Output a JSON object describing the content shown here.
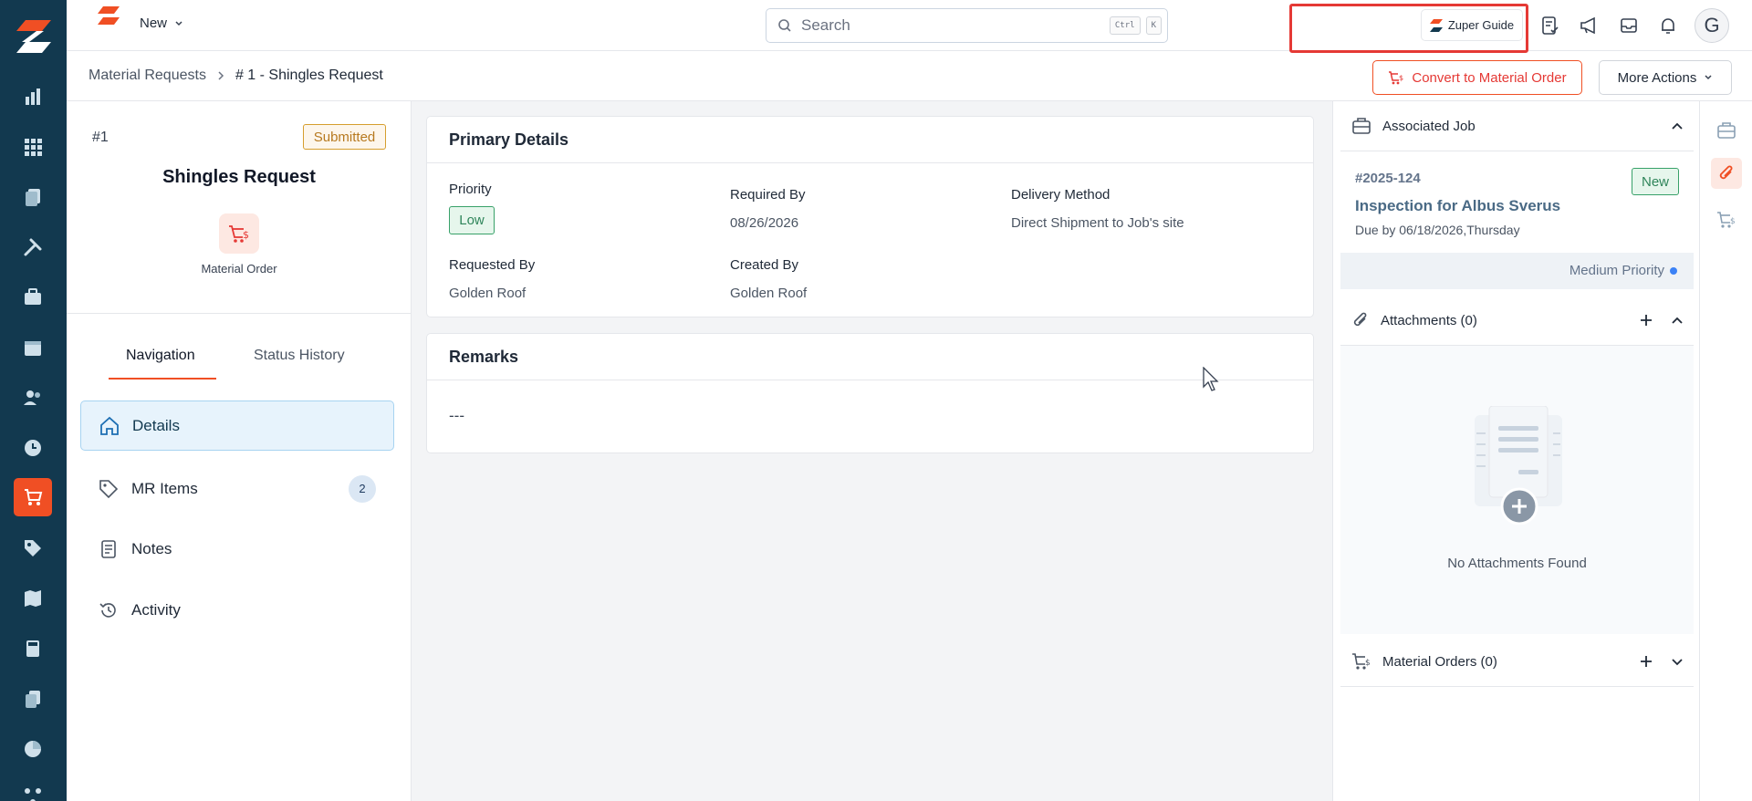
{
  "header": {
    "new_label": "New",
    "search_placeholder": "Search",
    "kbd_ctrl": "Ctrl",
    "kbd_k": "K",
    "guide_label": "Zuper Guide",
    "avatar_initial": "G"
  },
  "breadcrumb": {
    "parent": "Material Requests",
    "current": "# 1 - Shingles Request"
  },
  "actions": {
    "convert_label": "Convert to Material Order",
    "more_label": "More Actions"
  },
  "request": {
    "number": "#1",
    "status": "Submitted",
    "title": "Shingles Request",
    "type_label": "Material Order"
  },
  "nav": {
    "tabs": [
      "Navigation",
      "Status History"
    ],
    "items": [
      {
        "label": "Details"
      },
      {
        "label": "MR Items",
        "count": "2"
      },
      {
        "label": "Notes"
      },
      {
        "label": "Activity"
      }
    ]
  },
  "primary_details": {
    "heading": "Primary Details",
    "priority_label": "Priority",
    "priority_value": "Low",
    "required_by_label": "Required By",
    "required_by_value": "08/26/2026",
    "delivery_label": "Delivery Method",
    "delivery_value": "Direct Shipment to Job's site",
    "requested_by_label": "Requested By",
    "requested_by_value": "Golden Roof",
    "created_by_label": "Created By",
    "created_by_value": "Golden Roof"
  },
  "remarks": {
    "heading": "Remarks",
    "value": "---"
  },
  "associated_job": {
    "heading": "Associated Job",
    "number": "#2025-124",
    "status": "New",
    "title": "Inspection for Albus Sverus",
    "due": "Due by 06/18/2026,Thursday",
    "priority": "Medium Priority"
  },
  "attachments": {
    "heading": "Attachments (0)",
    "empty_text": "No Attachments Found"
  },
  "material_orders": {
    "heading": "Material Orders (0)"
  },
  "colors": {
    "brand": "#f04f24",
    "rail": "#12394f",
    "success": "#2f855a",
    "warning": "#b7791f",
    "highlight": "#e53935"
  }
}
